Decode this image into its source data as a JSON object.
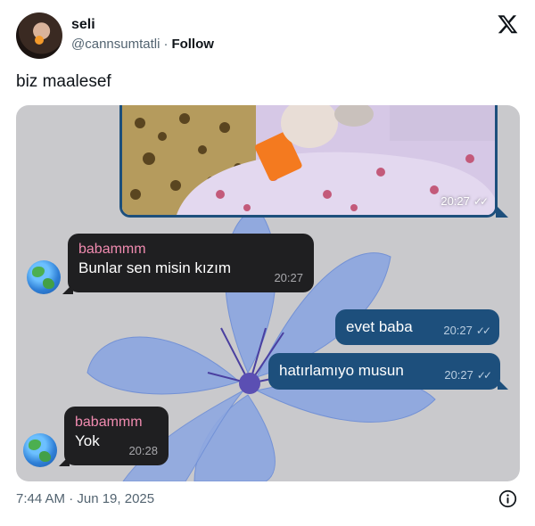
{
  "author": {
    "name": "seli",
    "handle": "@cannsumtatli",
    "separator": "·",
    "follow_label": "Follow"
  },
  "tweet": {
    "text": "biz maalesef",
    "timestamp": "7:44 AM · Jun 19, 2025"
  },
  "chat": {
    "photo_time": "20:27",
    "messages": [
      {
        "direction": "in",
        "sender": "babammm",
        "text": "Bunlar sen misin kızım",
        "time": "20:27"
      },
      {
        "direction": "out",
        "text": "evet baba",
        "time": "20:27",
        "status": "read"
      },
      {
        "direction": "out",
        "text": "hatırlamıyo musun",
        "time": "20:27",
        "status": "read"
      },
      {
        "direction": "in",
        "sender": "babammm",
        "text": "Yok",
        "time": "20:28"
      }
    ]
  },
  "colors": {
    "incoming_bubble": "#1f1f21",
    "outgoing_bubble": "#1d4f7c",
    "sender_name": "#f08bb0",
    "media_background": "#c9c9cc"
  },
  "icons": {
    "brand": "x-logo-icon",
    "read_receipt": "double-check-icon",
    "contact_avatar": "globe-icon",
    "info": "info-icon"
  }
}
